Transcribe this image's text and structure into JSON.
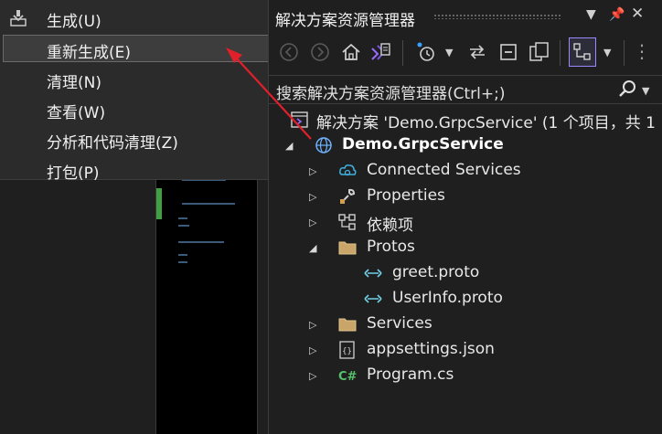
{
  "context_menu": {
    "items": [
      {
        "label": "生成(U)"
      },
      {
        "label": "重新生成(E)"
      },
      {
        "label": "清理(N)"
      },
      {
        "label": "查看(W)"
      },
      {
        "label": "分析和代码清理(Z)"
      },
      {
        "label": "打包(P)"
      }
    ]
  },
  "panel": {
    "title": "解决方案资源管理器",
    "search_placeholder": "搜索解决方案资源管理器(Ctrl+;)"
  },
  "tree": {
    "solution": "解决方案 'Demo.GrpcService' (1 个项目，共 1",
    "project": "Demo.GrpcService",
    "items": [
      {
        "label": "Connected Services"
      },
      {
        "label": "Properties"
      },
      {
        "label": "依赖项"
      },
      {
        "label": "Protos"
      },
      {
        "label": "greet.proto"
      },
      {
        "label": "UserInfo.proto"
      },
      {
        "label": "Services"
      },
      {
        "label": "appsettings.json"
      },
      {
        "label": "Program.cs"
      }
    ]
  },
  "colors": {
    "accent": "#9b87ff",
    "annotation_arrow": "#e0202a"
  }
}
